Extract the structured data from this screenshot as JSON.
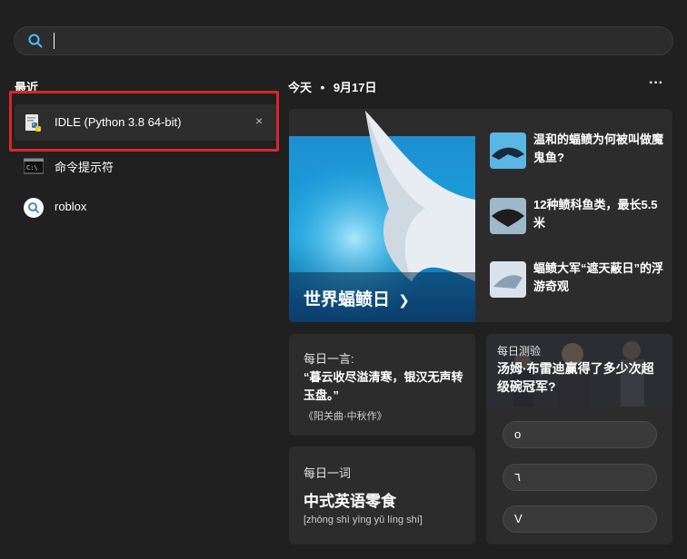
{
  "search": {
    "value": "",
    "icon": "search-icon"
  },
  "recent": {
    "title": "最近",
    "items": [
      {
        "label": "IDLE (Python 3.8 64-bit)",
        "icon": "python-idle-icon",
        "close": "×"
      },
      {
        "label": "命令提示符",
        "icon": "command-prompt-icon"
      },
      {
        "label": "roblox",
        "icon": "search-icon"
      }
    ]
  },
  "today": {
    "label": "今天",
    "dot": "•",
    "date": "9月17日",
    "more": "···"
  },
  "hero": {
    "title": "世界蝠鲼日",
    "arrow": "❯"
  },
  "news": [
    {
      "title": "温和的蝠鲼为何被叫做魔鬼鱼?"
    },
    {
      "title": "12种鲼科鱼类，最长5.5米"
    },
    {
      "title": "蝠鲼大军“遮天蔽日”的浮游奇观"
    }
  ],
  "quote": {
    "label": "每日一言:",
    "text": "“暮云收尽溢清寒，银汉无声转玉盘。”",
    "source": "《阳关曲·中秋作》"
  },
  "quiz": {
    "label": "每日测验",
    "question": "汤姆·布雷迪赢得了多少次超级碗冠军?",
    "options": [
      "o",
      "٦",
      "V"
    ]
  },
  "word": {
    "label": "每日一词",
    "term": "中式英语零食",
    "pinyin": "[zhōng shì yīng yǔ líng shí]"
  },
  "colors": {
    "background": "#202020",
    "card": "#2c2c2c",
    "highlight": "#d9262a",
    "accent": "#4cc2ff"
  }
}
